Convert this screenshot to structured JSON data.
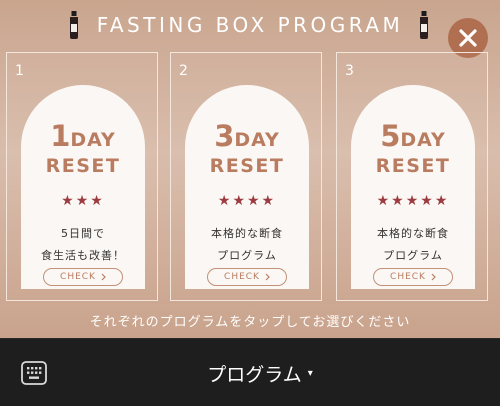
{
  "header": {
    "title": "FASTING BOX PROGRAM"
  },
  "programs": [
    {
      "number": "1",
      "days": "1",
      "unit": "DAY",
      "reset": "RESET",
      "stars": "★★★",
      "rating": 3,
      "desc_line1": "5日間で",
      "desc_line2": "食生活も改善！",
      "check_label": "CHECK"
    },
    {
      "number": "2",
      "days": "3",
      "unit": "DAY",
      "reset": "RESET",
      "stars": "★★★★",
      "rating": 4,
      "desc_line1": "本格的な断食",
      "desc_line2": "プログラム",
      "check_label": "CHECK"
    },
    {
      "number": "3",
      "days": "5",
      "unit": "DAY",
      "reset": "RESET",
      "stars": "★★★★★",
      "rating": 5,
      "desc_line1": "本格的な断食",
      "desc_line2": "プログラム",
      "check_label": "CHECK"
    }
  ],
  "instruction": "それぞれのプログラムをタップしてお選びください",
  "bottom_bar": {
    "menu_label": "プログラム",
    "caret": "▾",
    "keyboard_icon": "keyboard-icon"
  },
  "colors": {
    "panel": "#d2b09b",
    "accent": "#b97c60",
    "star": "#9c3c40",
    "close_bg": "#b06f50",
    "bar": "#1e1e1e"
  }
}
